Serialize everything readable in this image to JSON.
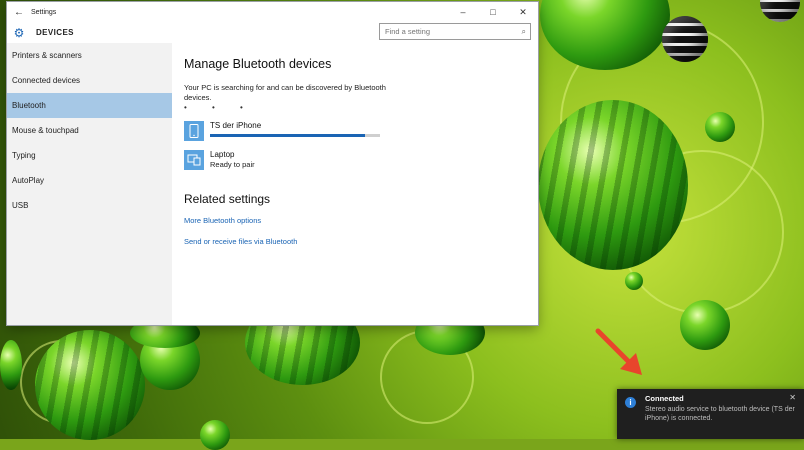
{
  "window": {
    "title": "Settings",
    "section": "DEVICES",
    "search_placeholder": "Find a setting",
    "controls": {
      "minimize": "–",
      "maximize": "□",
      "close": "✕"
    },
    "back_glyph": "←"
  },
  "sidebar": {
    "items": [
      {
        "label": "Printers & scanners"
      },
      {
        "label": "Connected devices"
      },
      {
        "label": "Bluetooth",
        "active": true
      },
      {
        "label": "Mouse & touchpad"
      },
      {
        "label": "Typing"
      },
      {
        "label": "AutoPlay"
      },
      {
        "label": "USB"
      }
    ]
  },
  "main": {
    "heading": "Manage Bluetooth devices",
    "description": "Your PC is searching for and can be discovered by Bluetooth devices.",
    "devices": [
      {
        "name": "TS der iPhone",
        "status": "",
        "icon": "phone-icon",
        "progress": 0.91
      },
      {
        "name": "Laptop",
        "status": "Ready to pair",
        "icon": "laptop-icon"
      }
    ],
    "related_heading": "Related settings",
    "links": [
      {
        "label": "More Bluetooth options"
      },
      {
        "label": "Send or receive files via Bluetooth"
      }
    ]
  },
  "toast": {
    "title": "Connected",
    "message": "Stereo audio service to bluetooth device (TS der iPhone) is connected.",
    "icon": "info-icon",
    "close": "✕"
  },
  "colors": {
    "accent": "#1a64b4",
    "active_nav": "#a6c8e6",
    "toast_bg": "#1f1f1f",
    "arrow": "#e8452c"
  }
}
